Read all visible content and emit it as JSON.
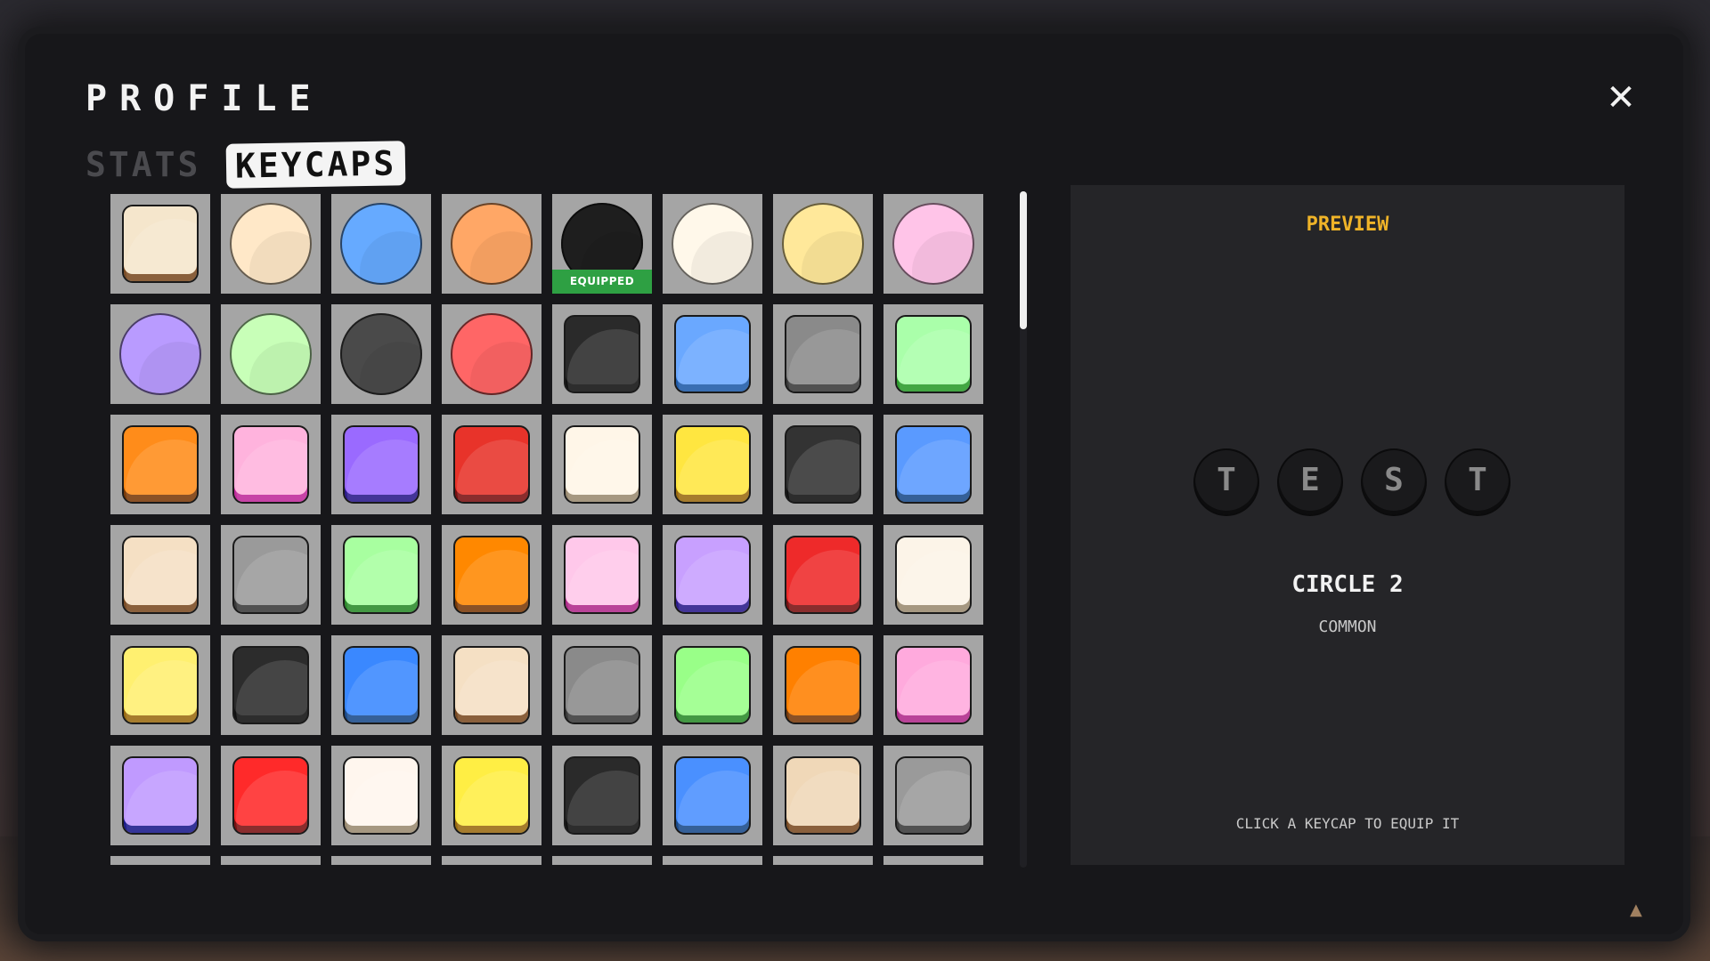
{
  "title": "PROFILE",
  "tabs": {
    "stats": "STATS",
    "keycaps": "KEYCAPS"
  },
  "equipped_label": "EQUIPPED",
  "preview": {
    "label": "PREVIEW",
    "keys": [
      "T",
      "E",
      "S",
      "T"
    ],
    "skin_name": "CIRCLE 2",
    "rarity": "COMMON",
    "hint": "CLICK A KEYCAP TO EQUIP IT"
  },
  "keycaps": [
    {
      "shape": "square",
      "color": "#f5e6cc",
      "base": "#7a4a22"
    },
    {
      "shape": "circle",
      "color": "#ffe8c8"
    },
    {
      "shape": "circle",
      "color": "#66aaff"
    },
    {
      "shape": "circle",
      "color": "#ffa766"
    },
    {
      "shape": "circle",
      "color": "#1e1e1e",
      "equipped": true
    },
    {
      "shape": "circle",
      "color": "#fff8ea"
    },
    {
      "shape": "circle",
      "color": "#ffe89a"
    },
    {
      "shape": "circle",
      "color": "#ffc4e8"
    },
    {
      "shape": "circle",
      "color": "#b99bff"
    },
    {
      "shape": "circle",
      "color": "#c8ffb8"
    },
    {
      "shape": "circle",
      "color": "#4a4a4a"
    },
    {
      "shape": "circle",
      "color": "#ff6666"
    },
    {
      "shape": "square",
      "color": "#2a2a2a",
      "base": "#111111"
    },
    {
      "shape": "square",
      "color": "#6aa8ff",
      "base": "#1e5aa8"
    },
    {
      "shape": "square",
      "color": "#8a8a8a",
      "base": "#3a3a3a"
    },
    {
      "shape": "square",
      "color": "#aaffaa",
      "base": "#2a9a2a"
    },
    {
      "shape": "square",
      "color": "#ff8c1a",
      "base": "#7a3a08"
    },
    {
      "shape": "square",
      "color": "#ffb3dd",
      "base": "#c02a9a"
    },
    {
      "shape": "square",
      "color": "#9a6aff",
      "base": "#2a1a8a"
    },
    {
      "shape": "square",
      "color": "#e8332a",
      "base": "#7a1010"
    },
    {
      "shape": "square",
      "color": "#fff6e8",
      "base": "#9a8a70"
    },
    {
      "shape": "square",
      "color": "#ffe640",
      "base": "#9a6a10"
    },
    {
      "shape": "square",
      "color": "#333333",
      "base": "#111111"
    },
    {
      "shape": "square",
      "color": "#5a9aff",
      "base": "#1a4a8a"
    },
    {
      "shape": "square",
      "color": "#f5e0c4",
      "base": "#7a4a22"
    },
    {
      "shape": "square",
      "color": "#9a9a9a",
      "base": "#3a3a3a"
    },
    {
      "shape": "square",
      "color": "#a8ffa0",
      "base": "#2a8a2a"
    },
    {
      "shape": "square",
      "color": "#ff8800",
      "base": "#7a3a08"
    },
    {
      "shape": "square",
      "color": "#ffc8ea",
      "base": "#b02a8a"
    },
    {
      "shape": "square",
      "color": "#c8a0ff",
      "base": "#2a1a8a"
    },
    {
      "shape": "square",
      "color": "#ee2a2a",
      "base": "#7a1010"
    },
    {
      "shape": "square",
      "color": "#fcf4e8",
      "base": "#9a8a70"
    },
    {
      "shape": "square",
      "color": "#fff070",
      "base": "#9a6a10"
    },
    {
      "shape": "square",
      "color": "#2c2c2c",
      "base": "#111111"
    },
    {
      "shape": "square",
      "color": "#3a88ff",
      "base": "#1a4a8a"
    },
    {
      "shape": "square",
      "color": "#f5e0c4",
      "base": "#7a4a22"
    },
    {
      "shape": "square",
      "color": "#8a8a8a",
      "base": "#3a3a3a"
    },
    {
      "shape": "square",
      "color": "#99ff88",
      "base": "#2a8a2a"
    },
    {
      "shape": "square",
      "color": "#ff8000",
      "base": "#7a3a08"
    },
    {
      "shape": "square",
      "color": "#ffaadd",
      "base": "#b02a8a"
    },
    {
      "shape": "square",
      "color": "#c09aff",
      "base": "#1a1a8a"
    },
    {
      "shape": "square",
      "color": "#ff2a2a",
      "base": "#7a1010"
    },
    {
      "shape": "square",
      "color": "#fff6ee",
      "base": "#9a8a70"
    },
    {
      "shape": "square",
      "color": "#ffee44",
      "base": "#9a6a10"
    },
    {
      "shape": "square",
      "color": "#2a2a2a",
      "base": "#111111"
    },
    {
      "shape": "square",
      "color": "#4a90ff",
      "base": "#1a4a8a"
    },
    {
      "shape": "square",
      "color": "#f0d8b8",
      "base": "#7a4a22"
    },
    {
      "shape": "square",
      "color": "#9a9a9a",
      "base": "#3a3a3a"
    },
    {
      "shape": "square",
      "color": "#3a3a3a",
      "base": "#111111"
    },
    {
      "shape": "square",
      "color": "#4a3a3a",
      "base": "#111111"
    },
    {
      "shape": "square",
      "color": "#3a3a3a",
      "base": "#111111"
    },
    {
      "shape": "square",
      "color": "#3a3a3a",
      "base": "#111111"
    },
    {
      "shape": "square",
      "color": "#4a3434",
      "base": "#111111"
    },
    {
      "shape": "square",
      "color": "#3a3a3a",
      "base": "#111111"
    },
    {
      "shape": "square",
      "color": "#2a2a2a",
      "base": "#111111"
    },
    {
      "shape": "square",
      "color": "#3a3a3a",
      "base": "#111111"
    }
  ]
}
